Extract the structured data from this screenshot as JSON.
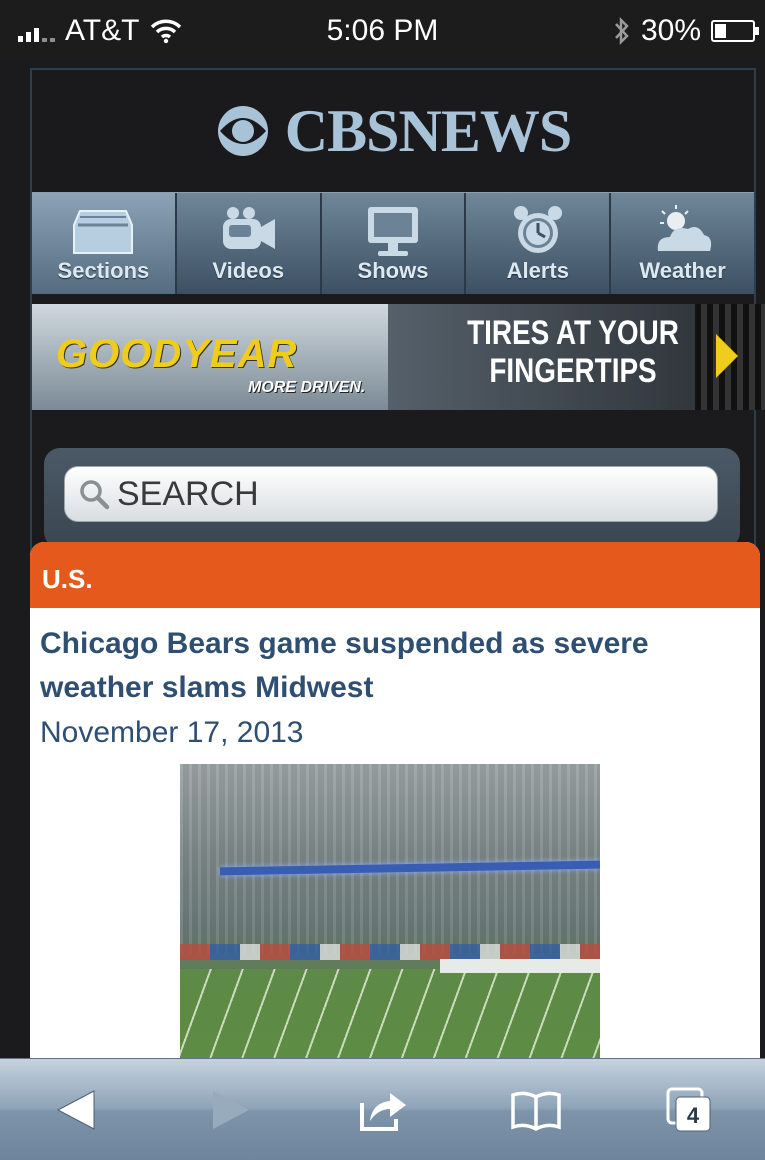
{
  "status_bar": {
    "carrier": "AT&T",
    "time": "5:06 PM",
    "battery": "30%",
    "battery_level": 0.3
  },
  "masthead": {
    "logo_text": "CBSNEWS"
  },
  "nav": {
    "items": [
      {
        "label": "Sections",
        "icon": "sections-icon",
        "active": true
      },
      {
        "label": "Videos",
        "icon": "video-camera-icon",
        "active": false
      },
      {
        "label": "Shows",
        "icon": "monitor-icon",
        "active": false
      },
      {
        "label": "Alerts",
        "icon": "alarm-clock-icon",
        "active": false
      },
      {
        "label": "Weather",
        "icon": "weather-cloud-icon",
        "active": false
      }
    ]
  },
  "ad": {
    "brand": "GOODYEAR",
    "tagline": "MORE DRIVEN.",
    "headline_line1": "TIRES AT YOUR",
    "headline_line2": "FINGERTIPS"
  },
  "search": {
    "placeholder": "SEARCH"
  },
  "article": {
    "section": "U.S.",
    "headline": "Chicago Bears game suspended as severe weather slams Midwest",
    "date": "November 17, 2013"
  },
  "toolbar": {
    "tab_count": "4"
  },
  "colors": {
    "section_orange": "#e55a1c",
    "headline_blue": "#2e4e72",
    "logo_blue": "#a8c2d8"
  }
}
